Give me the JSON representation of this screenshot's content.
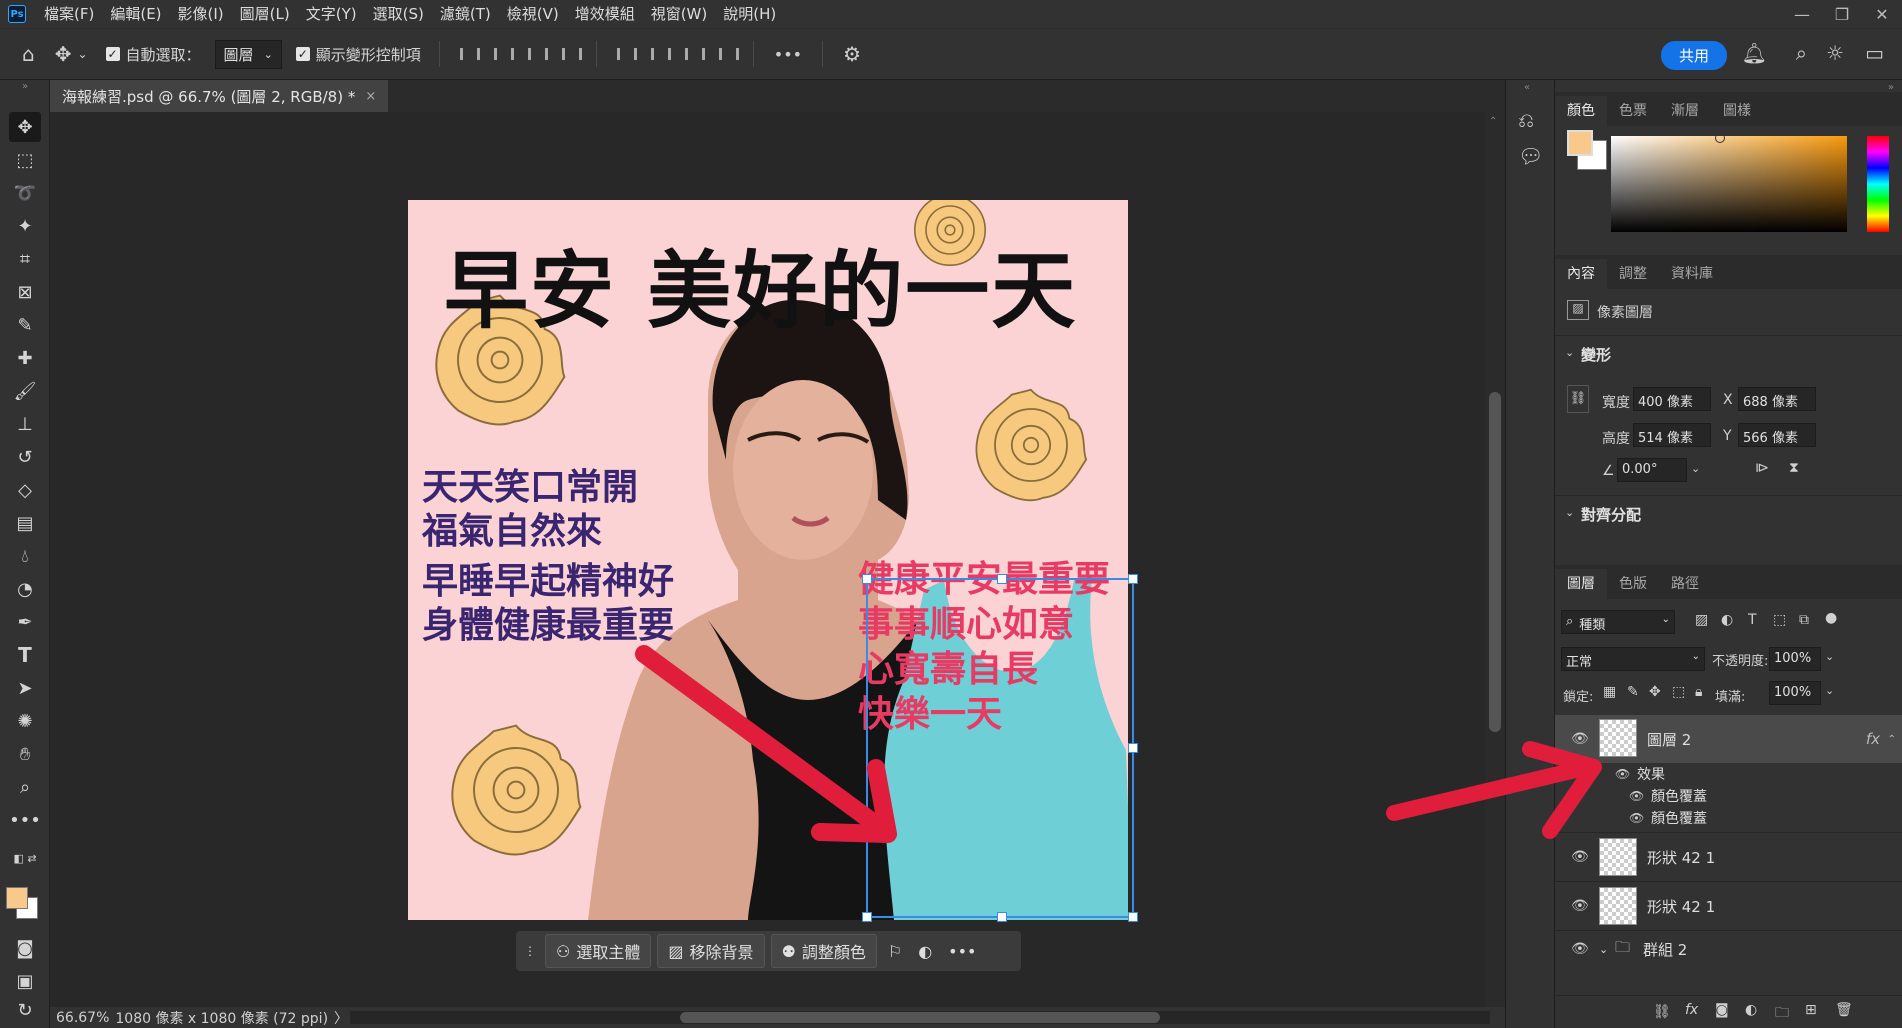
{
  "menu": {
    "items": [
      "檔案(F)",
      "編輯(E)",
      "影像(I)",
      "圖層(L)",
      "文字(Y)",
      "選取(S)",
      "濾鏡(T)",
      "檢視(V)",
      "增效模組",
      "視窗(W)",
      "說明(H)"
    ]
  },
  "options": {
    "auto_select_label": "自動選取：",
    "auto_select_value": "圖層",
    "show_transform_label": "顯示變形控制項",
    "more_label": "•••",
    "share_label": "共用"
  },
  "document": {
    "tab_title": "海報練習.psd @ 66.7% (圖層 2, RGB/8) *",
    "close_glyph": "×"
  },
  "poster": {
    "title": "早安 美好的一天",
    "purple_lines": [
      "天天笑口常開",
      "福氣自然來",
      "早睡早起精神好",
      "身體健康最重要"
    ],
    "pink_lines": [
      "健康平安最重要",
      "事事順心如意",
      "心寬壽自長",
      "快樂一天"
    ]
  },
  "taskbar": {
    "select_subject": "選取主體",
    "remove_bg": "移除背景",
    "adjust_color": "調整顏色",
    "more": "•••"
  },
  "status": {
    "zoom": "66.67%",
    "doc_info": "1080 像素 x 1080 像素 (72 ppi)",
    "chevron": "〉"
  },
  "color_panel": {
    "tabs": [
      "顏色",
      "色票",
      "漸層",
      "圖樣"
    ],
    "foreground": "#f8c98a",
    "background": "#ffffff"
  },
  "properties_panel": {
    "tabs": [
      "內容",
      "調整",
      "資料庫"
    ],
    "layer_kind": "像素圖層",
    "transform_title": "變形",
    "width_label": "寬度",
    "width_value": "400 像素",
    "height_label": "高度",
    "height_value": "514 像素",
    "x_label": "X",
    "x_value": "688 像素",
    "y_label": "Y",
    "y_value": "566 像素",
    "angle_value": "0.00°",
    "align_title": "對齊分配"
  },
  "layers_panel": {
    "tabs": [
      "圖層",
      "色版",
      "路徑"
    ],
    "filter_kind": "種類",
    "blend_mode": "正常",
    "opacity_label": "不透明度:",
    "opacity_value": "100%",
    "lock_label": "鎖定:",
    "fill_label": "填滿:",
    "fill_value": "100%",
    "layers": [
      {
        "name": "圖層 2",
        "fx": "fx"
      },
      {
        "name": "效果"
      },
      {
        "name": "顏色覆蓋"
      },
      {
        "name": "顏色覆蓋"
      },
      {
        "name": "形狀 42 1"
      },
      {
        "name": "形狀 42 1"
      },
      {
        "name": "群組 2"
      }
    ],
    "footer_fx": "fx"
  },
  "colors": {
    "accent_blue": "#1473e6",
    "selection_blue": "#3a8be8",
    "annotation_red": "#e01e3c",
    "poster_pink": "#fcd3d5",
    "dress_cyan": "#6fcfd6"
  }
}
